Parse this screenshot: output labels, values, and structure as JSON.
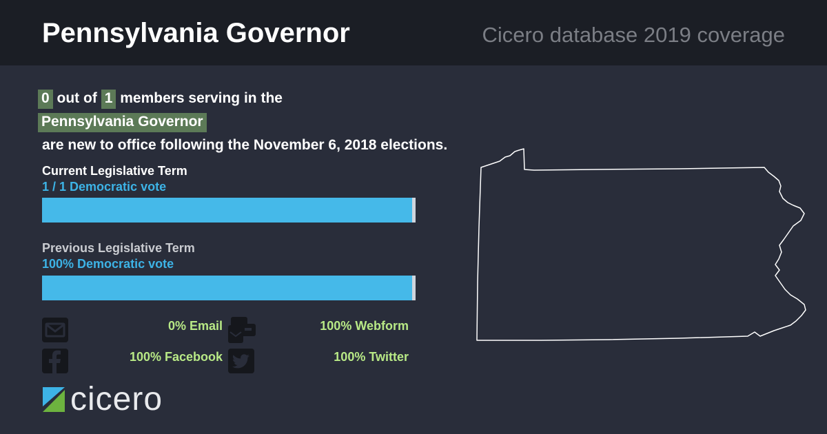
{
  "header": {
    "title": "Pennsylvania Governor",
    "subtitle": "Cicero database 2019 coverage"
  },
  "summary": {
    "new_count": "0",
    "out_of_text": "out of",
    "total_count": "1",
    "members_text": "members serving in the",
    "body_name": "Pennsylvania Governor",
    "closing_text": "are new to office following the November 6, 2018 elections."
  },
  "current_term": {
    "label": "Current Legislative Term",
    "vote_text": "1 / 1 Democratic vote",
    "democratic_fraction": 0.99
  },
  "previous_term": {
    "label": "Previous Legislative Term",
    "vote_text": "100% Democratic vote",
    "democratic_fraction": 0.99
  },
  "channels": {
    "email": {
      "icon": "envelope-icon",
      "value": "0% Email"
    },
    "webform": {
      "icon": "webform-icon",
      "value": "100% Webform"
    },
    "facebook": {
      "icon": "facebook-icon",
      "value": "100% Facebook"
    },
    "twitter": {
      "icon": "twitter-icon",
      "value": "100% Twitter"
    }
  },
  "logo": {
    "text": "cicero"
  },
  "map": {
    "icon": "pennsylvania-state-outline"
  },
  "colors": {
    "background": "#292d3a",
    "header_background": "#1b1e25",
    "highlight": "#5c7a57",
    "democratic_bar": "#45b9e9",
    "vote_text": "#3db3e6",
    "channel_value": "#b8e986"
  }
}
